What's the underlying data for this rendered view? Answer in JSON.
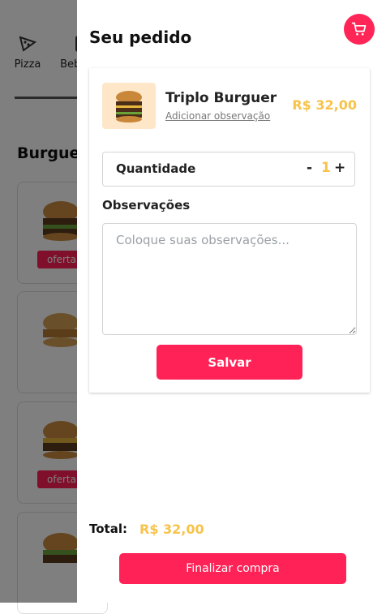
{
  "background": {
    "categories": [
      {
        "label": "Pizza",
        "icon": "pizza-icon"
      },
      {
        "label": "Bebidas",
        "icon": "drink-icon"
      }
    ],
    "section_title": "Burgueres",
    "offer_label": "oferta"
  },
  "panel": {
    "title": "Seu pedido",
    "cart_icon": "cart-icon",
    "item": {
      "name": "Triplo Burguer",
      "add_note": "Adicionar observação",
      "price": "R$ 32,00"
    },
    "quantity": {
      "label": "Quantidade",
      "minus": "-",
      "value": "1",
      "plus": "+"
    },
    "notes": {
      "label": "Observações",
      "placeholder": "Coloque suas observações..."
    },
    "save_label": "Salvar",
    "total_label": "Total:",
    "total_value": "R$ 32,00",
    "checkout_label": "Finalizar compra"
  },
  "colors": {
    "accent": "#ff2256",
    "price": "#f7c34a",
    "overlay": "rgba(0,0,0,0.5)"
  }
}
